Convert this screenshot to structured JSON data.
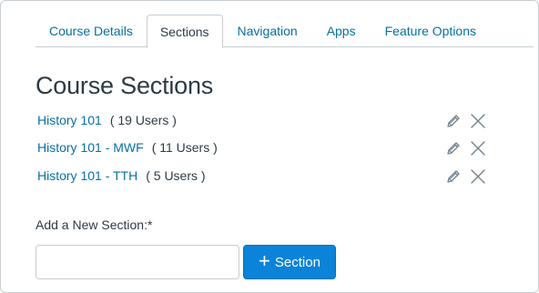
{
  "tabs": [
    {
      "label": "Course Details",
      "active": false
    },
    {
      "label": "Sections",
      "active": true
    },
    {
      "label": "Navigation",
      "active": false
    },
    {
      "label": "Apps",
      "active": false
    },
    {
      "label": "Feature Options",
      "active": false
    }
  ],
  "page_title": "Course Sections",
  "sections": [
    {
      "name": "History 101",
      "users": "( 19 Users )"
    },
    {
      "name": "History 101 - MWF",
      "users": "( 11 Users )"
    },
    {
      "name": "History 101 - TTH",
      "users": "( 5 Users )"
    }
  ],
  "row_icons": {
    "edit": "pencil-icon",
    "delete": "close-icon"
  },
  "add_section": {
    "label": "Add a New Section:*",
    "input_value": "",
    "input_placeholder": "",
    "button_icon": "+",
    "button_label": "Section"
  },
  "colors": {
    "link": "#0770a3",
    "text": "#2d3b45",
    "border": "#c7cdd1",
    "button": "#0b83d9",
    "icon": "#73818c"
  }
}
